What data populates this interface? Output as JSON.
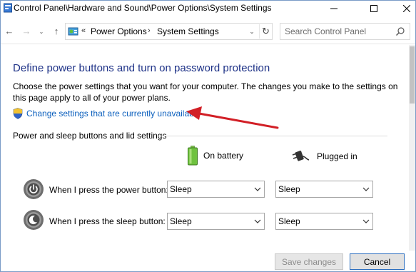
{
  "window": {
    "title": "Control Panel\\Hardware and Sound\\Power Options\\System Settings"
  },
  "nav": {
    "back_label": "←",
    "forward_label": "→",
    "recent_label": "⌄",
    "up_label": "↑",
    "overflow_label": "«",
    "breadcrumbs": [
      "Power Options",
      "System Settings"
    ],
    "separator": "›",
    "dropdown_label": "⌄",
    "refresh_label": "↻",
    "search_placeholder": "Search Control Panel"
  },
  "content": {
    "heading": "Define power buttons and turn on password protection",
    "description": "Choose the power settings that you want for your computer. The changes you make to the settings on this page apply to all of your power plans.",
    "change_link": "Change settings that are currently unavailable",
    "section_label": "Power and sleep buttons and lid settings",
    "columns": {
      "battery": "On battery",
      "plugged": "Plugged in"
    },
    "rows": [
      {
        "label": "When I press the power button:",
        "battery": "Sleep",
        "plugged": "Sleep"
      },
      {
        "label": "When I press the sleep button:",
        "battery": "Sleep",
        "plugged": "Sleep"
      }
    ]
  },
  "footer": {
    "save_label": "Save changes",
    "cancel_label": "Cancel"
  },
  "colors": {
    "heading": "#1e3287",
    "link": "#0b5fbd",
    "annotation_arrow": "#d21f26"
  },
  "icons": {
    "app": "control-panel-icon",
    "shield": "uac-shield-icon",
    "battery": "battery-icon",
    "plug": "plug-icon",
    "power_button": "power-button-icon",
    "sleep_button": "sleep-button-icon"
  }
}
